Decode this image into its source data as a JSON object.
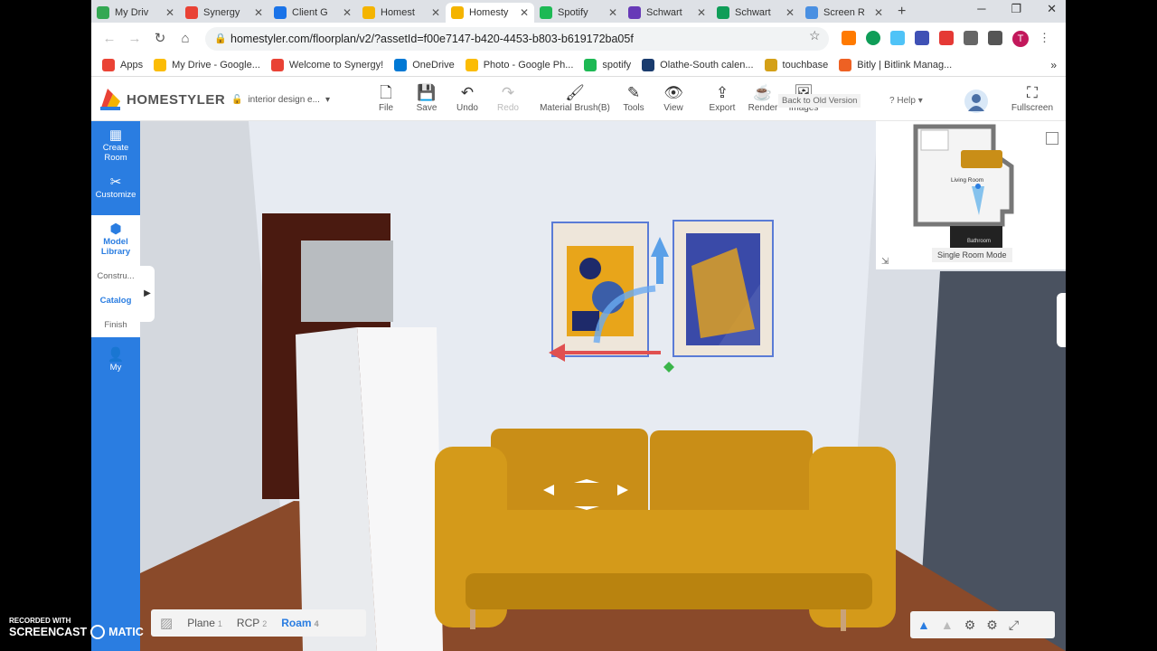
{
  "browser": {
    "tabs": [
      {
        "label": "My Driv",
        "color": "#34a853"
      },
      {
        "label": "Synergy",
        "color": "#e94235"
      },
      {
        "label": "Client G",
        "color": "#1a73e8"
      },
      {
        "label": "Homest",
        "color": "#f4b400"
      },
      {
        "label": "Homesty",
        "color": "#f4b400",
        "active": true
      },
      {
        "label": "Spotify",
        "color": "#1db954"
      },
      {
        "label": "Schwart",
        "color": "#673ab7"
      },
      {
        "label": "Schwart",
        "color": "#0f9d58"
      },
      {
        "label": "Screen R",
        "color": "#4a90e2"
      }
    ],
    "new_tab": "+",
    "url": "homestyler.com/floorplan/v2/?assetId=f00e7147-b420-4453-b803-b619172ba05f",
    "profile_initial": "T",
    "bookmarks": [
      {
        "label": "Apps",
        "color": "#ea4335"
      },
      {
        "label": "My Drive - Google...",
        "color": "#fbbc05"
      },
      {
        "label": "Welcome to Synergy!",
        "color": "#e94235"
      },
      {
        "label": "OneDrive",
        "color": "#0078d4"
      },
      {
        "label": "Photo - Google Ph...",
        "color": "#fbbc05"
      },
      {
        "label": "spotify",
        "color": "#1db954"
      },
      {
        "label": "Olathe-South calen...",
        "color": "#1a3c6e"
      },
      {
        "label": "touchbase",
        "color": "#d4a017"
      },
      {
        "label": "Bitly | Bitlink Manag...",
        "color": "#ee6123"
      }
    ],
    "more": "»"
  },
  "app": {
    "logo": "HOMESTYLER",
    "project": "interior design e...",
    "tools": [
      {
        "label": "File",
        "icon": "file-icon",
        "glyph": "🗋"
      },
      {
        "label": "Save",
        "icon": "save-icon",
        "glyph": "💾"
      },
      {
        "label": "Undo",
        "icon": "undo-icon",
        "glyph": "↶"
      },
      {
        "label": "Redo",
        "icon": "redo-icon",
        "glyph": "↷"
      },
      {
        "label": "Material Brush(B)",
        "icon": "brush-icon",
        "glyph": "🖌"
      },
      {
        "label": "Tools",
        "icon": "tools-icon",
        "glyph": "✎"
      },
      {
        "label": "View",
        "icon": "eye-icon",
        "glyph": "👁"
      },
      {
        "label": "Export",
        "icon": "export-icon",
        "glyph": "⇪"
      },
      {
        "label": "Render",
        "icon": "render-icon",
        "glyph": "☕"
      },
      {
        "label": "Images",
        "icon": "images-icon",
        "glyph": "🖼"
      }
    ],
    "back_old": "Back to Old Version",
    "help": "Help",
    "fullscreen": "Fullscreen"
  },
  "sidebar": {
    "items": [
      {
        "label": "Create Room",
        "glyph": "▦"
      },
      {
        "label": "Customize",
        "glyph": "✂"
      },
      {
        "label": "Model Library",
        "glyph": "⬢"
      }
    ],
    "subitems": [
      "Constru...",
      "Catalog",
      "Finish"
    ],
    "my": "My"
  },
  "minimap": {
    "room1": "Living Room",
    "room2": "Bathroom",
    "mode": "Single Room Mode"
  },
  "viewmodes": [
    {
      "label": "Plane",
      "n": "1"
    },
    {
      "label": "RCP",
      "n": "2"
    },
    {
      "label": "Roam",
      "n": "4",
      "active": true
    }
  ],
  "watermark": {
    "line1": "RECORDED WITH",
    "line2a": "SCREENCAST",
    "line2b": "MATIC"
  },
  "colors": {
    "accent": "#2a7de1",
    "sofa": "#d49a1a",
    "floor": "#8a4a2a"
  }
}
